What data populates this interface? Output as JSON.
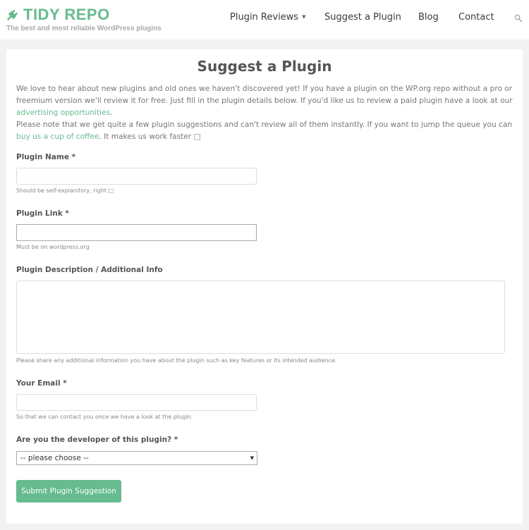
{
  "site": {
    "title": "TIDY REPO",
    "tagline": "The best and most reliable WordPress plugins",
    "brand_color": "#66bb8f"
  },
  "nav": {
    "items": [
      {
        "label": "Plugin Reviews",
        "has_dropdown": true
      },
      {
        "label": "Suggest a Plugin",
        "active": true
      },
      {
        "label": "Blog"
      },
      {
        "label": "Contact"
      }
    ],
    "search_icon": "search-icon"
  },
  "page": {
    "title": "Suggest a Plugin",
    "intro": {
      "p1_text": "We love to hear about new plugins and old ones we haven't discovered yet! If you have a plugin on the WP.org repo without a pro or freemium version we'll review it for free. Just fill in the plugin details below. If you'd like us to review a paid plugin have a look at our ",
      "p1_link": "advertising opportunities",
      "p1_end": ".",
      "p2_text": "Please note that we get quite a few plugin suggestions and can't review all of them instantly. If you want to jump the queue you can ",
      "p2_link": "buy us a cup of coffee",
      "p2_end": ". It makes us work faster □"
    }
  },
  "form": {
    "plugin_name": {
      "label": "Plugin Name *",
      "value": "",
      "hint": "Should be self-explanitory, right □"
    },
    "plugin_link": {
      "label": "Plugin Link *",
      "value": "",
      "hint": "Must be on wordpress.org"
    },
    "description": {
      "label": "Plugin Description / Additional Info",
      "value": "",
      "hint": "Please share any additional information you have about the plugin such as key features or its intended audience."
    },
    "email": {
      "label": "Your Email *",
      "value": "",
      "hint": "So that we can contact you once we have a look at the plugin."
    },
    "developer": {
      "label": "Are you the developer of this plugin? *",
      "selected": "-- please choose --"
    },
    "submit_label": "Submit Plugin Suggestion"
  }
}
